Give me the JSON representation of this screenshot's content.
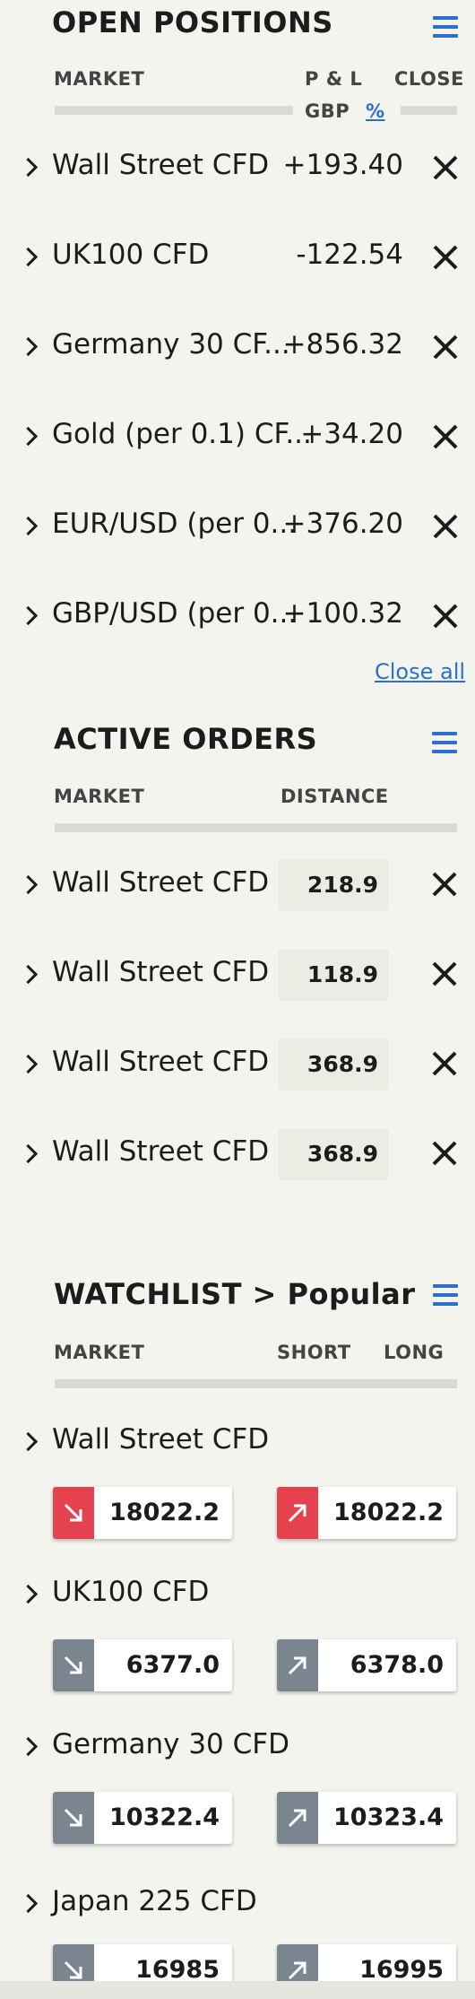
{
  "open_positions": {
    "title": "OPEN POSITIONS",
    "menu_icon": "hamburger-icon",
    "col_market": "MARKET",
    "col_pl": "P & L",
    "col_close": "CLOSE",
    "unit_gbp": "GBP",
    "unit_pct": "%",
    "rows": [
      {
        "market": "Wall Street CFD",
        "pl": "+193.40"
      },
      {
        "market": "UK100 CFD",
        "pl": "-122.54"
      },
      {
        "market": "Germany 30 CF...",
        "pl": "+856.32"
      },
      {
        "market": "Gold (per 0.1) CF...",
        "pl": "+34.20"
      },
      {
        "market": "EUR/USD (per 0...",
        "pl": "+376.20"
      },
      {
        "market": "GBP/USD (per 0...",
        "pl": "+100.32"
      }
    ],
    "close_all": "Close all"
  },
  "active_orders": {
    "title": "ACTIVE ORDERS",
    "col_market": "MARKET",
    "col_distance": "DISTANCE",
    "rows": [
      {
        "market": "Wall Street CFD",
        "distance": "218.9"
      },
      {
        "market": "Wall Street CFD",
        "distance": "118.9"
      },
      {
        "market": "Wall Street CFD",
        "distance": "368.9"
      },
      {
        "market": "Wall Street CFD",
        "distance": "368.9"
      }
    ]
  },
  "watchlist": {
    "title": "WATCHLIST > Popular",
    "col_market": "MARKET",
    "col_short": "SHORT",
    "col_long": "LONG",
    "colors": {
      "red": "#e4424f",
      "grey": "#7b8590"
    },
    "rows": [
      {
        "market": "Wall Street CFD",
        "short": "18022.2",
        "long": "18022.2",
        "short_color": "red",
        "long_color": "red"
      },
      {
        "market": "UK100 CFD",
        "short": "6377.0",
        "long": "6378.0",
        "short_color": "grey",
        "long_color": "grey"
      },
      {
        "market": "Germany 30 CFD",
        "short": "10322.4",
        "long": "10323.4",
        "short_color": "grey",
        "long_color": "grey"
      },
      {
        "market": "Japan 225 CFD",
        "short": "16985",
        "long": "16995",
        "short_color": "grey",
        "long_color": "grey"
      }
    ]
  }
}
